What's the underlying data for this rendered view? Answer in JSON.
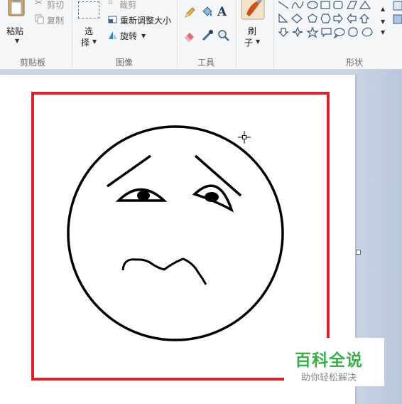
{
  "ribbon": {
    "clipboard": {
      "paste_label": "粘贴",
      "cut_label": "剪切",
      "copy_label": "复制",
      "group_label": "剪贴板"
    },
    "image": {
      "select_label": "选",
      "select_label2": "择",
      "crop_label": "裁剪",
      "resize_label": "重新调整大小",
      "rotate_label": "旋转",
      "group_label": "图像"
    },
    "tools": {
      "group_label": "工具"
    },
    "brushes": {
      "label": "刷",
      "label2": "子"
    },
    "shapes": {
      "group_label": "形状"
    }
  },
  "watermark": {
    "title": "百科全说",
    "subtitle": "助你轻松解决"
  },
  "colors": {
    "frame_red": "#d9222c",
    "watermark_green": "#37b04a"
  }
}
